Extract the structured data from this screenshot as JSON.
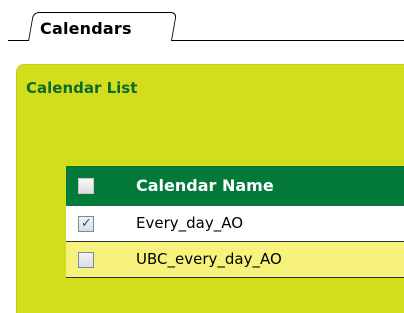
{
  "tabs": [
    {
      "label": "Calendars",
      "active": true
    }
  ],
  "panel": {
    "title": "Calendar List"
  },
  "table": {
    "columns": [
      "",
      "Calendar Name"
    ],
    "rows": [
      {
        "name": "Every_day_AO",
        "checked": true
      },
      {
        "name": "UBC_every_day_AO",
        "checked": false
      }
    ]
  },
  "colors": {
    "panel_bg": "#d4dd1b",
    "header_bg": "#047a3a",
    "title_text": "#0b6b2e",
    "row_alt_bg": "#f6f27c"
  }
}
